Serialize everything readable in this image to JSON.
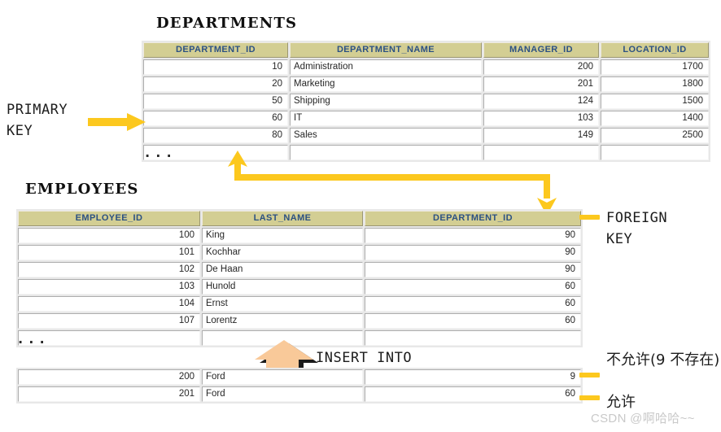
{
  "departments": {
    "title": "DEPARTMENTS",
    "columns": [
      "DEPARTMENT_ID",
      "DEPARTMENT_NAME",
      "MANAGER_ID",
      "LOCATION_ID"
    ],
    "rows": [
      [
        "10",
        "Administration",
        "200",
        "1700"
      ],
      [
        "20",
        "Marketing",
        "201",
        "1800"
      ],
      [
        "50",
        "Shipping",
        "124",
        "1500"
      ],
      [
        "60",
        "IT",
        "103",
        "1400"
      ],
      [
        "80",
        "Sales",
        "149",
        "2500"
      ]
    ],
    "ellipsis": "..."
  },
  "employees": {
    "title": "EMPLOYEES",
    "columns": [
      "EMPLOYEE_ID",
      "LAST_NAME",
      "DEPARTMENT_ID"
    ],
    "rows": [
      [
        "100",
        "King",
        "90"
      ],
      [
        "101",
        "Kochhar",
        "90"
      ],
      [
        "102",
        "De Haan",
        "90"
      ],
      [
        "103",
        "Hunold",
        "60"
      ],
      [
        "104",
        "Ernst",
        "60"
      ],
      [
        "107",
        "Lorentz",
        "60"
      ]
    ],
    "ellipsis": "...",
    "inserted_rows": [
      [
        "200",
        "Ford",
        "9"
      ],
      [
        "201",
        "Ford",
        "60"
      ]
    ]
  },
  "annotations": {
    "primary_key": "PRIMARY\nKEY",
    "foreign_key": "FOREIGN\nKEY",
    "insert_into": "INSERT INTO",
    "not_allowed": "不允许(9 不存在)",
    "allowed": "允许"
  },
  "watermark": "CSDN @啊哈哈~~",
  "colors": {
    "header_bg": "#d3ce93",
    "header_text": "#2c5182",
    "arrow_yellow": "#fcc81e",
    "insert_arrow": "#f9c999",
    "grid_bg": "#e8e8e8"
  }
}
